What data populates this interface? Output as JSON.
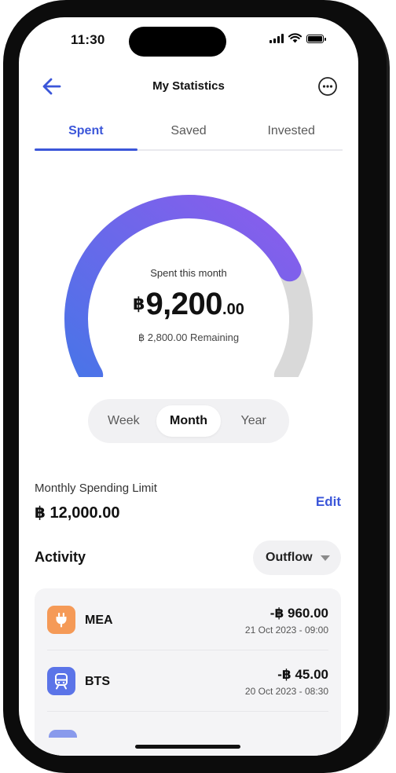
{
  "status_bar": {
    "time": "11:30"
  },
  "header": {
    "title": "My Statistics"
  },
  "tabs": [
    {
      "label": "Spent",
      "active": true
    },
    {
      "label": "Saved",
      "active": false
    },
    {
      "label": "Invested",
      "active": false
    }
  ],
  "gauge": {
    "label": "Spent this month",
    "currency": "฿",
    "amount_int": "9,200",
    "amount_dec": ".00",
    "remaining": "฿ 2,800.00 Remaining",
    "spent": 9200,
    "limit": 12000,
    "gradient_start": "#4a74e8",
    "gradient_end": "#8b5cec",
    "track_color": "#d9d9d9"
  },
  "period": {
    "options": [
      "Week",
      "Month",
      "Year"
    ],
    "selected": "Month"
  },
  "limit": {
    "label": "Monthly Spending Limit",
    "value": "฿ 12,000.00",
    "edit_label": "Edit"
  },
  "activity": {
    "title": "Activity",
    "filter_label": "Outflow",
    "transactions": [
      {
        "name": "MEA",
        "amount": "-฿ 960.00",
        "date": "21 Oct 2023 - 09:00",
        "icon": "plug-icon",
        "icon_color": "#f59a57"
      },
      {
        "name": "BTS",
        "amount": "-฿ 45.00",
        "date": "20 Oct 2023 - 08:30",
        "icon": "train-icon",
        "icon_color": "#5b74e8"
      }
    ]
  },
  "colors": {
    "accent": "#3b56d9"
  }
}
